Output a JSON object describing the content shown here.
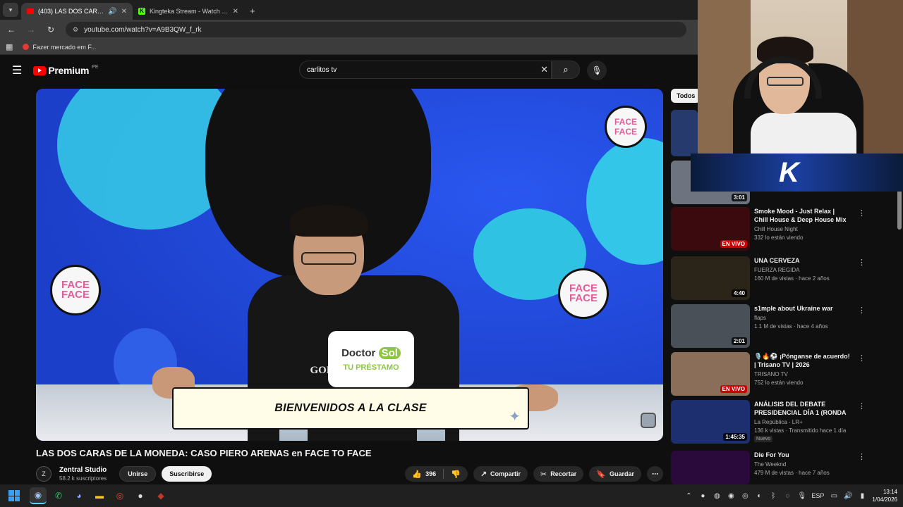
{
  "browser": {
    "tabs": [
      {
        "title": "(403) LAS DOS CARAS DE L",
        "favicon": "youtube-icon",
        "active": true
      },
      {
        "title": "Kingteka Stream - Watch Live o",
        "favicon": "kick-icon",
        "active": false
      }
    ],
    "url": "youtube.com/watch?v=A9B3QW_f_rk",
    "bookmark": "Fazer mercado em F..."
  },
  "youtube": {
    "logo_text": "Premium",
    "country_code": "PE",
    "search_value": "carlitos tv"
  },
  "video": {
    "shirt_text": "GODS BY",
    "sponsor_name_a": "Doctor",
    "sponsor_name_b": "Sol",
    "sponsor_tagline": "TU PRÉSTAMO",
    "caption": "BIENVENIDOS A LA CLASE",
    "sticker_text": "FACE FACE",
    "title": "LAS DOS CARAS DE LA MONEDA: CASO PIERO ARENAS en FACE TO FACE",
    "channel": "Zentral Studio",
    "subscribers": "58.2 k suscriptores",
    "join_label": "Unirse",
    "subscribe_label": "Suscribirse",
    "likes": "396",
    "share_label": "Compartir",
    "clip_label": "Recortar",
    "save_label": "Guardar"
  },
  "recommendations": {
    "chip": "Todos",
    "items": [
      {
        "title": "Smoke Mood - Just Relax | Chill House & Deep House Mix 🎧 ...",
        "channel": "Chill House Night",
        "stats": "332 lo están viendo",
        "badge": "EN VIVO",
        "thumb_color": "#3a0a0e"
      },
      {
        "title": "UNA CERVEZA",
        "channel": "FUERZA REGIDA",
        "stats": "160 M de vistas · hace 2 años",
        "badge": "4:40",
        "thumb_color": "#2b2418"
      },
      {
        "title": "s1mple about Ukraine war",
        "channel": "flaps",
        "stats": "1.1 M de vistas · hace 4 años",
        "badge": "2:01",
        "thumb_color": "#4a5058"
      },
      {
        "title": "🎙️🔥⚽ ¡Pónganse de acuerdo! | Trisano TV | 2026",
        "channel": "TRISANO TV",
        "stats": "752 lo están viendo",
        "badge": "EN VIVO",
        "thumb_color": "#8a6e5a"
      },
      {
        "title": "ANÁLISIS DEL DEBATE PRESIDENCIAL DÍA 1 (RONDA ...",
        "channel": "La República - LR+",
        "stats": "136 k vistas · Transmitido hace 1 día",
        "badge": "1:45:35",
        "extra": "Nuevo",
        "thumb_color": "#1d2f6e"
      },
      {
        "title": "Die For You",
        "channel": "The Weeknd",
        "stats": "479 M de vistas · hace 7 años",
        "badge": "",
        "thumb_color": "#2a0a3a"
      }
    ],
    "partial_badge": "3:01"
  },
  "taskbar": {
    "lang": "ESP",
    "time": "13:14",
    "date": "1/04/2026"
  }
}
